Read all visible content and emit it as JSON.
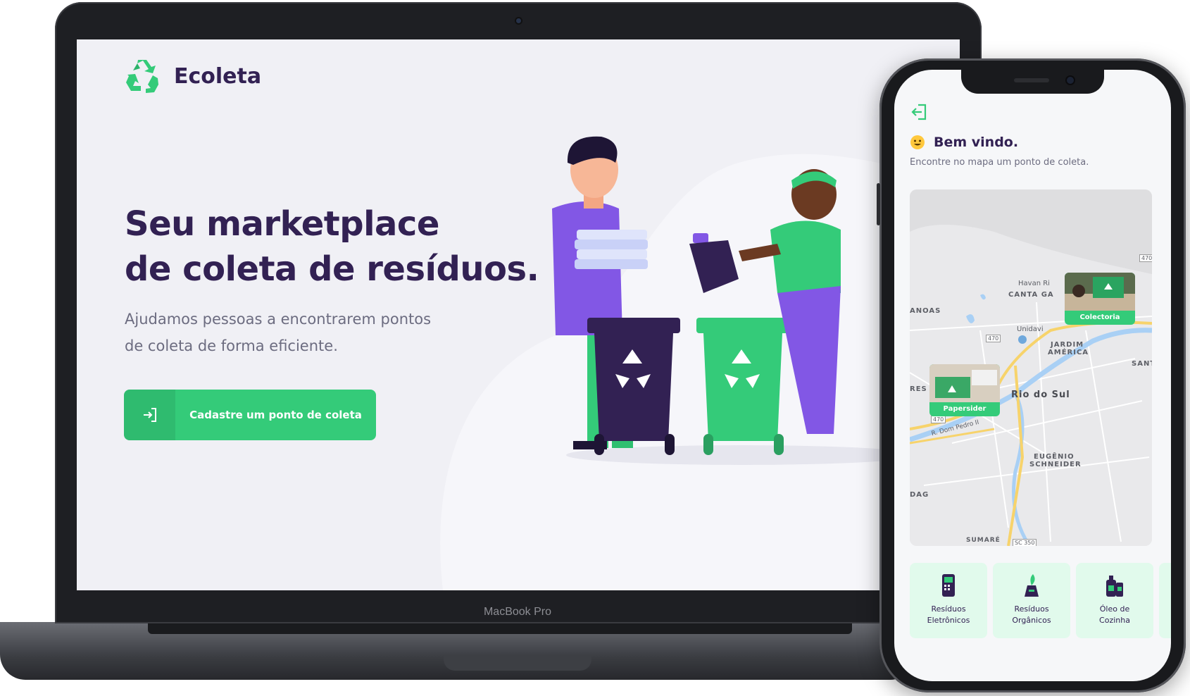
{
  "laptop": {
    "model_label": "MacBook Pro",
    "brand": "Ecoleta",
    "hero_title_line1": "Seu marketplace",
    "hero_title_line2": "de coleta de resíduos.",
    "hero_sub_line1": "Ajudamos pessoas a encontrarem pontos",
    "hero_sub_line2": "de coleta de forma eficiente.",
    "cta_label": "Cadastre um ponto de coleta"
  },
  "phone": {
    "welcome_title": "Bem vindo.",
    "welcome_sub": "Encontre no mapa um ponto de coleta.",
    "map": {
      "labels": {
        "havan": "Havan Ri",
        "canta_galo": "CANTA GA",
        "canoas": "ANOAS",
        "unidavi": "Unidavi",
        "jardim1": "JARDIM",
        "jardim2": "AMÉRICA",
        "santa": "SANT",
        "rio_do_sul": "Rio do Sul",
        "progresso": "RES",
        "r_dom_pedro": "R. Dom Pedro II",
        "eugenio1": "EUGÊNIO",
        "eugenio2": "SCHNEIDER",
        "dag": "DAG",
        "sumare": "SUMARÉ",
        "route_470a": "470",
        "route_470b": "470",
        "route_470c": "470",
        "route_sc350": "SC 350"
      },
      "markers": [
        {
          "name": "Colectoria"
        },
        {
          "name": "Papersider"
        }
      ]
    },
    "items": [
      {
        "label": "Resíduos\nEletrônicos",
        "icon": "battery-icon"
      },
      {
        "label": "Resíduos\nOrgânicos",
        "icon": "compost-icon"
      },
      {
        "label": "Óleo de\nCozinha",
        "icon": "oil-icon"
      }
    ]
  },
  "colors": {
    "primary": "#34cb79",
    "title": "#322153",
    "text": "#6c6c80",
    "background": "#f0f0f5",
    "item_bg": "#e1faec"
  }
}
